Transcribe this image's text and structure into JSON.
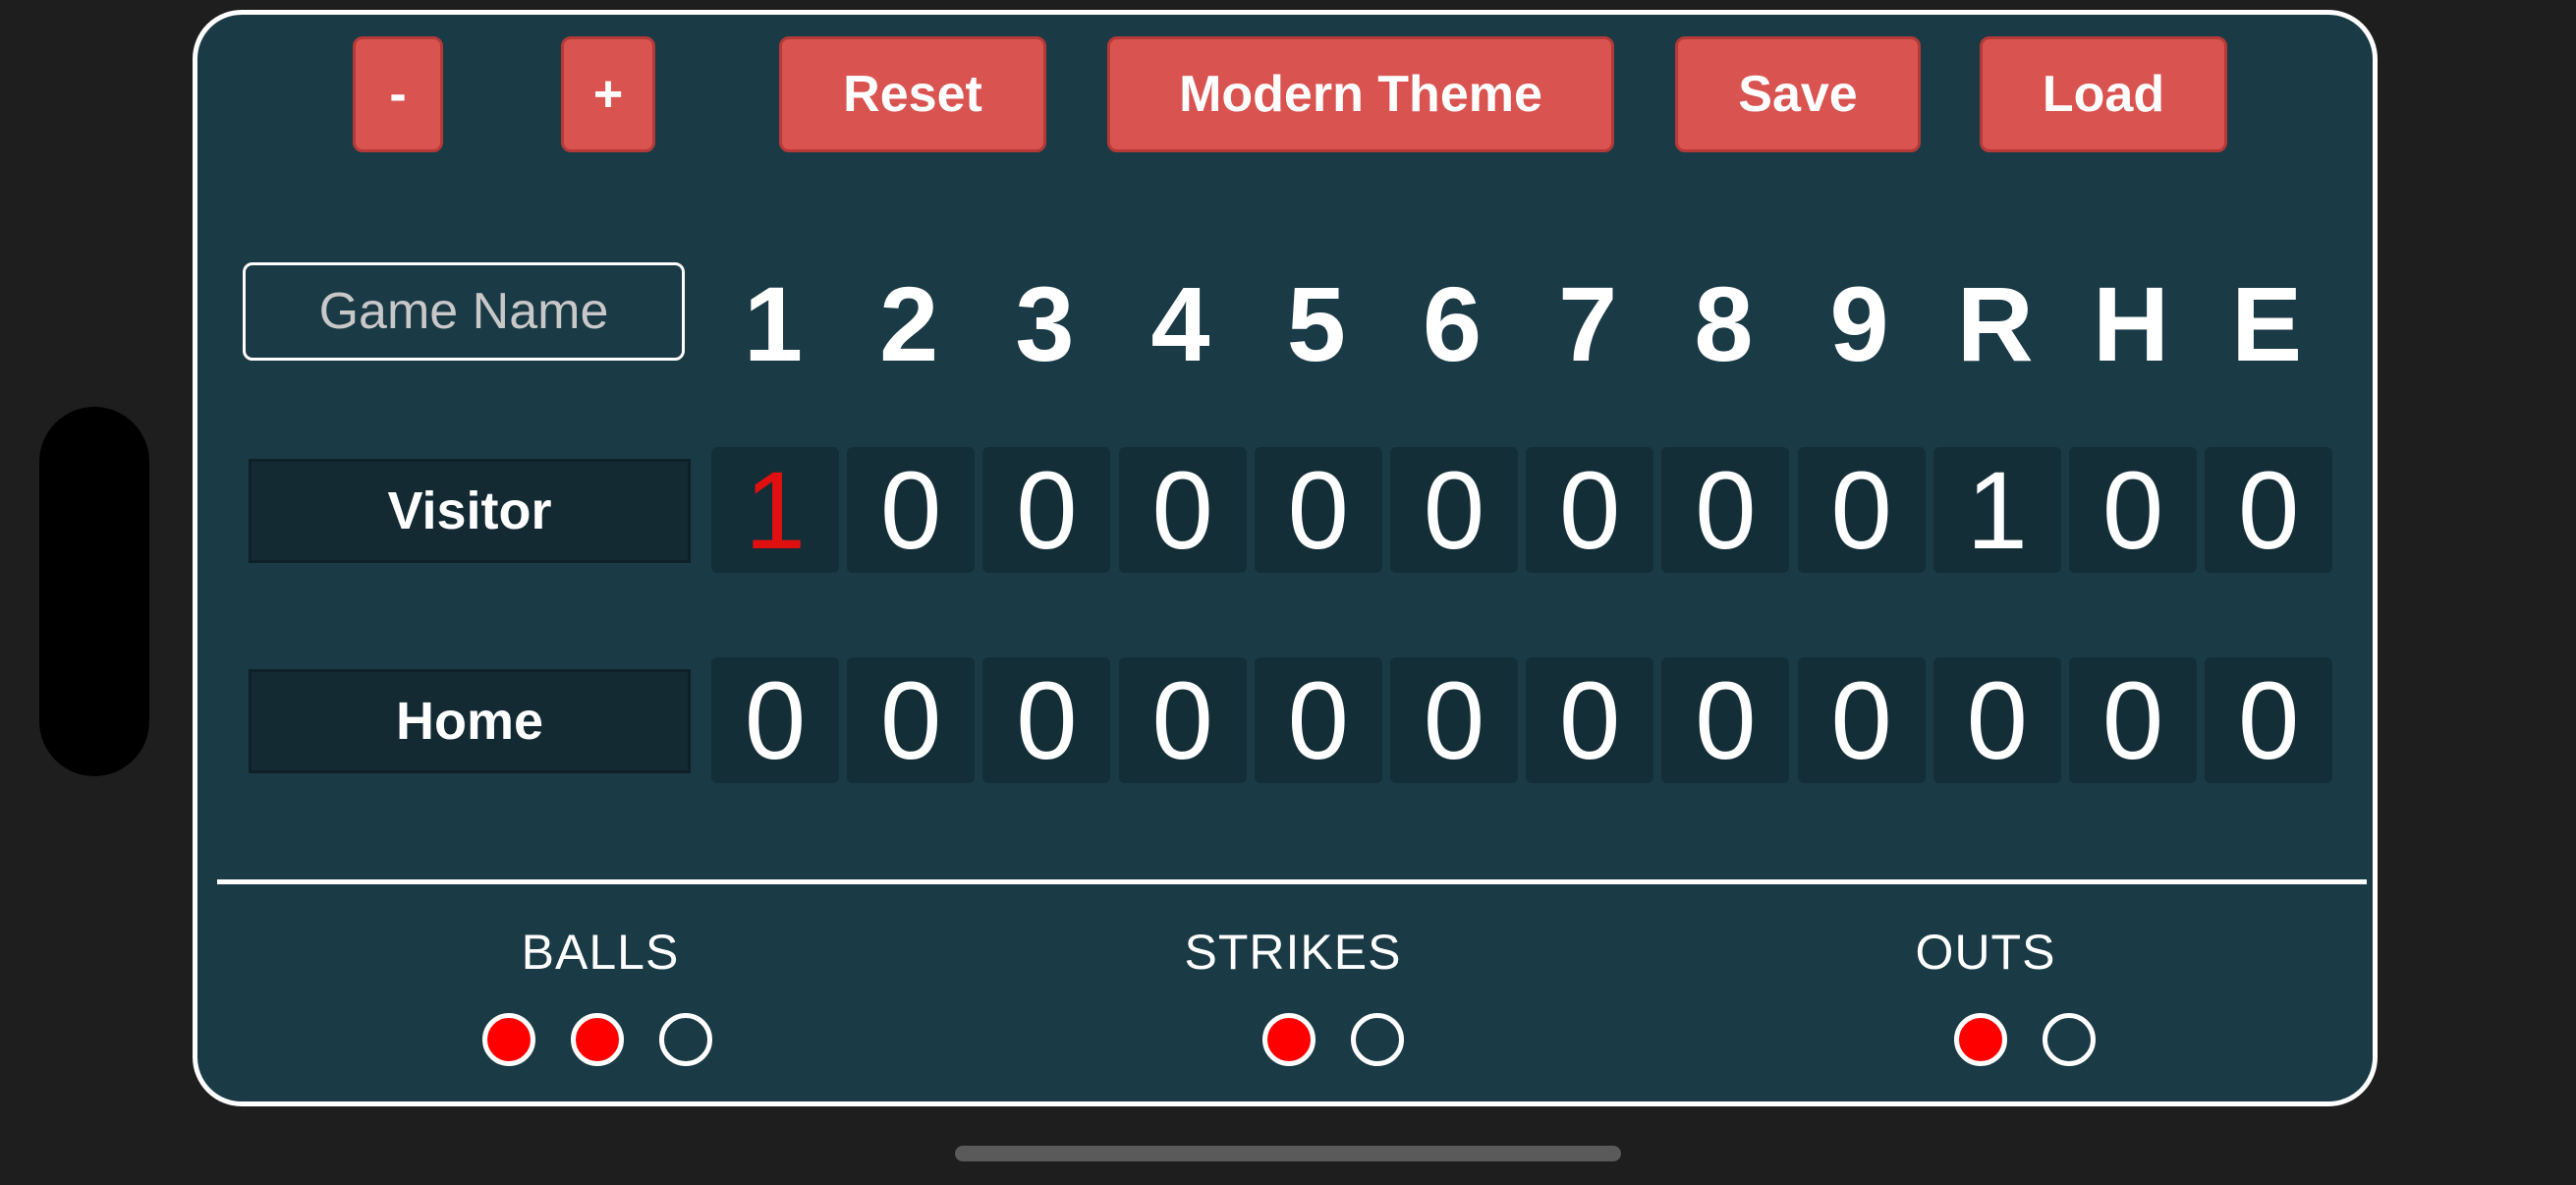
{
  "toolbar": {
    "minus_label": "-",
    "plus_label": "+",
    "reset_label": "Reset",
    "theme_label": "Modern Theme",
    "save_label": "Save",
    "load_label": "Load"
  },
  "game_name": {
    "placeholder": "Game Name",
    "value": ""
  },
  "columns": [
    "1",
    "2",
    "3",
    "4",
    "5",
    "6",
    "7",
    "8",
    "9",
    "R",
    "H",
    "E"
  ],
  "teams": [
    {
      "name": "Visitor",
      "scores": [
        "1",
        "0",
        "0",
        "0",
        "0",
        "0",
        "0",
        "0",
        "0",
        "1",
        "0",
        "0"
      ],
      "highlight_index": 0
    },
    {
      "name": "Home",
      "scores": [
        "0",
        "0",
        "0",
        "0",
        "0",
        "0",
        "0",
        "0",
        "0",
        "0",
        "0",
        "0"
      ],
      "highlight_index": -1
    }
  ],
  "count": {
    "balls": {
      "label": "BALLS",
      "total": 3,
      "filled": 2
    },
    "strikes": {
      "label": "STRIKES",
      "total": 2,
      "filled": 1
    },
    "outs": {
      "label": "OUTS",
      "total": 2,
      "filled": 1
    }
  },
  "colors": {
    "board_bg": "#1a3a46",
    "button_bg": "#d95450",
    "highlight_text": "#e01010",
    "dot_filled": "#ff0000"
  }
}
